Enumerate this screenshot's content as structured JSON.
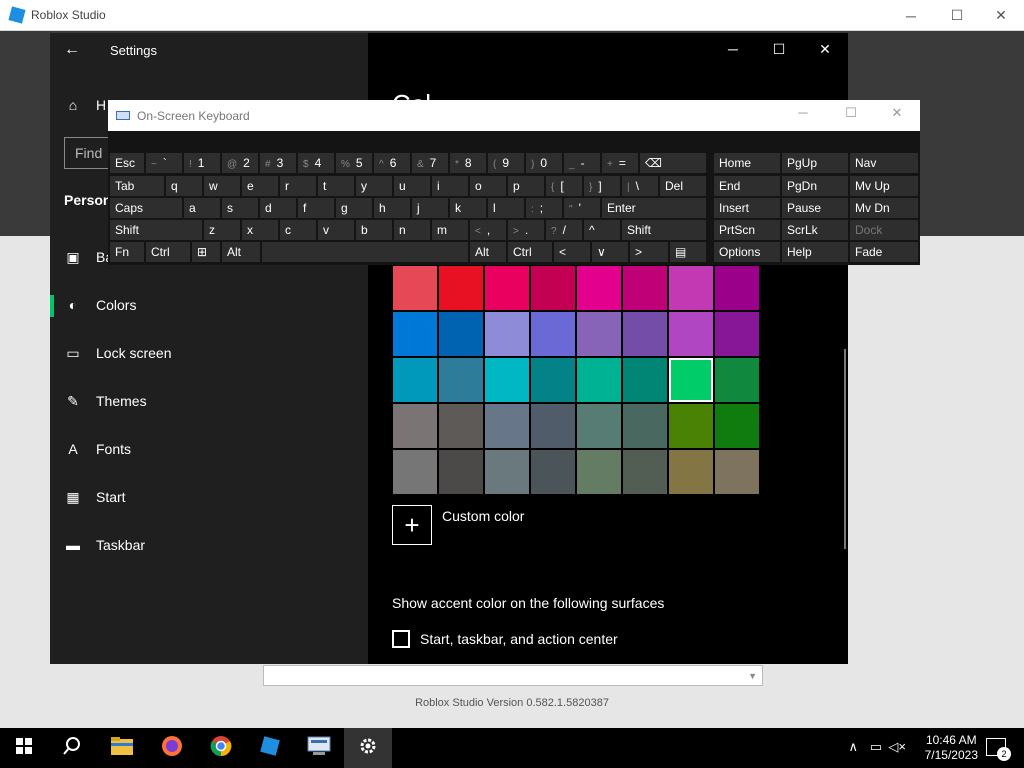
{
  "roblox": {
    "title": "Roblox Studio",
    "version": "Roblox Studio Version 0.582.1.5820387",
    "controls": {
      "minimize": "─",
      "maximize": "☐",
      "close": "✕"
    }
  },
  "settings": {
    "title": "Settings",
    "back": "←",
    "home_label": "H",
    "find_placeholder": "Find",
    "section": "Person",
    "heading": "Col",
    "controls": {
      "minimize": "─",
      "maximize": "☐",
      "close": "✕"
    },
    "nav": [
      {
        "label": "Ba",
        "icon": "image-icon"
      },
      {
        "label": "Colors",
        "icon": "palette-icon"
      },
      {
        "label": "Lock screen",
        "icon": "lock-screen-icon"
      },
      {
        "label": "Themes",
        "icon": "themes-icon"
      },
      {
        "label": "Fonts",
        "icon": "fonts-icon"
      },
      {
        "label": "Start",
        "icon": "start-icon"
      },
      {
        "label": "Taskbar",
        "icon": "taskbar-icon"
      }
    ],
    "swatch_colors": [
      [
        "#e74856",
        "#e81123",
        "#ea005e",
        "#c30052",
        "#e3008c",
        "#bf0077",
        "#c239b3",
        "#9a0089"
      ],
      [
        "#0078d7",
        "#0063b1",
        "#8e8cd8",
        "#6b69d6",
        "#8764b8",
        "#744da9",
        "#b146c2",
        "#881798"
      ],
      [
        "#0099bc",
        "#2d7d9a",
        "#00b7c3",
        "#038387",
        "#00b294",
        "#018574",
        "#00cc6a",
        "#10893e"
      ],
      [
        "#7a7574",
        "#5d5a58",
        "#68768a",
        "#515c6b",
        "#567c73",
        "#486860",
        "#498205",
        "#107c10"
      ],
      [
        "#767676",
        "#4c4a48",
        "#69797e",
        "#4a5459",
        "#647c64",
        "#525e54",
        "#847545",
        "#7e735f"
      ]
    ],
    "selected_swatch": "#00cc6a",
    "custom_color": "Custom color",
    "surfaces_heading": "Show accent color on the following surfaces",
    "surfaces_checkbox": "Start, taskbar, and action center"
  },
  "osk": {
    "title": "On-Screen Keyboard",
    "controls": {
      "minimize": "─",
      "maximize": "☐",
      "close": "✕"
    },
    "rows": [
      [
        [
          "Esc",
          ""
        ],
        [
          "`",
          "~"
        ],
        [
          "1",
          "!"
        ],
        [
          "2",
          "@"
        ],
        [
          "3",
          "#"
        ],
        [
          "4",
          "$"
        ],
        [
          "5",
          "%"
        ],
        [
          "6",
          "^"
        ],
        [
          "7",
          "&"
        ],
        [
          "8",
          "*"
        ],
        [
          "9",
          "("
        ],
        [
          "0",
          ")"
        ],
        [
          "-",
          "_"
        ],
        [
          "=",
          "+"
        ],
        [
          "⌫",
          ""
        ]
      ],
      [
        [
          "Tab",
          ""
        ],
        [
          "q",
          ""
        ],
        [
          "w",
          ""
        ],
        [
          "e",
          ""
        ],
        [
          "r",
          ""
        ],
        [
          "t",
          ""
        ],
        [
          "y",
          ""
        ],
        [
          "u",
          ""
        ],
        [
          "i",
          ""
        ],
        [
          "o",
          ""
        ],
        [
          "p",
          ""
        ],
        [
          "[",
          "{"
        ],
        [
          "]",
          "}"
        ],
        [
          "\\",
          "|"
        ],
        [
          "Del",
          ""
        ]
      ],
      [
        [
          "Caps",
          ""
        ],
        [
          "a",
          ""
        ],
        [
          "s",
          ""
        ],
        [
          "d",
          ""
        ],
        [
          "f",
          ""
        ],
        [
          "g",
          ""
        ],
        [
          "h",
          ""
        ],
        [
          "j",
          ""
        ],
        [
          "k",
          ""
        ],
        [
          "l",
          ""
        ],
        [
          ";",
          ":"
        ],
        [
          "'",
          "\""
        ],
        [
          "Enter",
          ""
        ]
      ],
      [
        [
          "Shift",
          ""
        ],
        [
          "z",
          ""
        ],
        [
          "x",
          ""
        ],
        [
          "c",
          ""
        ],
        [
          "v",
          ""
        ],
        [
          "b",
          ""
        ],
        [
          "n",
          ""
        ],
        [
          "m",
          ""
        ],
        [
          ",",
          "<"
        ],
        [
          ".",
          ">"
        ],
        [
          "/",
          "?"
        ],
        [
          "^",
          ""
        ],
        [
          "Shift",
          ""
        ]
      ],
      [
        [
          "Fn",
          ""
        ],
        [
          "Ctrl",
          ""
        ],
        [
          "⊞",
          ""
        ],
        [
          "Alt",
          ""
        ],
        [
          "",
          ""
        ],
        [
          "Alt",
          ""
        ],
        [
          "Ctrl",
          ""
        ],
        [
          "<",
          ""
        ],
        [
          "∨",
          ""
        ],
        [
          ">",
          ""
        ],
        [
          "▤",
          ""
        ]
      ]
    ],
    "nav_keys": [
      [
        "Home",
        "PgUp",
        "Nav"
      ],
      [
        "End",
        "PgDn",
        "Mv Up"
      ],
      [
        "Insert",
        "Pause",
        "Mv Dn"
      ],
      [
        "PrtScn",
        "ScrLk",
        "Dock"
      ],
      [
        "Options",
        "Help",
        "Fade"
      ]
    ]
  },
  "taskbar": {
    "time": "10:46 AM",
    "date": "7/15/2023",
    "notifications": "2",
    "apps": [
      "start-icon",
      "search-icon",
      "file-explorer-icon",
      "firefox-icon",
      "chrome-icon",
      "roblox-studio-icon",
      "control-panel-icon",
      "settings-icon"
    ]
  }
}
